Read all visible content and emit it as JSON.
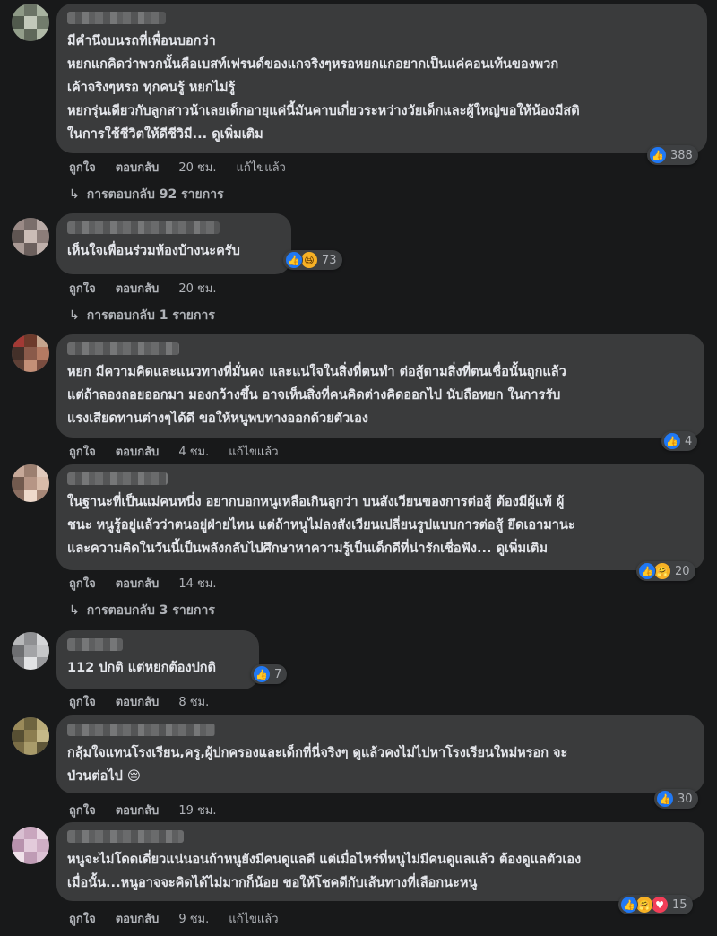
{
  "comments": [
    {
      "lines": [
        "มีคำนึงบนรถที่เพื่อนบอกว่า",
        "หยกแกคิดว่าพวกนั้นคือเบสท์เฟรนด์ของแกจริงๆหรอหยกแกอยากเป็นแค่คอนเท้นของพวก",
        "เค้าจริงๆหรอ ทุกคนรู้ หยกไม่รู้",
        "หยกรุ่นเดียวกับลูกสาวน้าเลยเด็กอายุแค่นี้มันคาบเกี่ยวระหว่างวัยเด็กและผู้ใหญ่ขอให้น้องมีสติ",
        "ในการใช้ชีวิตให้ดีชีวิมี..."
      ],
      "see_more": "ดูเพิ่มเติม",
      "reactions": [
        "like"
      ],
      "reaction_count": "388",
      "like_label": "ถูกใจ",
      "reply_label": "ตอบกลับ",
      "time": "20 ชม.",
      "edited": "แก้ไขแล้ว",
      "replies": "การตอบกลับ 92 รายการ"
    },
    {
      "lines": [
        "เห็นใจเพื่อนร่วมห้องบ้างนะครับ"
      ],
      "see_more": "",
      "reactions": [
        "like",
        "haha"
      ],
      "reaction_count": "73",
      "like_label": "ถูกใจ",
      "reply_label": "ตอบกลับ",
      "time": "20 ชม.",
      "edited": "",
      "replies": "การตอบกลับ 1 รายการ"
    },
    {
      "lines": [
        "หยก มีความคิดและแนวทางที่มั่นคง และแน่ใจในสิ่งที่ตนทำ ต่อสู้ตามสิ่งที่ตนเชื่อนั้นถูกแล้ว",
        "แต่ถ้าลองถอยออกมา มองกว้างขึ้น อาจเห็นสิ่งที่คนคิดต่างคิดออกไป นับถือหยก ในการรับ",
        "แรงเสียดทานต่างๆได้ดี ขอให้หนูพบทางออกด้วยตัวเอง"
      ],
      "see_more": "",
      "reactions": [
        "like"
      ],
      "reaction_count": "4",
      "like_label": "ถูกใจ",
      "reply_label": "ตอบกลับ",
      "time": "4 ชม.",
      "edited": "แก้ไขแล้ว",
      "replies": ""
    },
    {
      "lines": [
        "ในฐานะที่เป็นแม่คนหนึ่ง อยากบอกหนูเหลือเกินลูกว่า บนสังเวียนของการต่อสู้ ต้องมีผู้แพ้ ผู้",
        "ชนะ หนูรู้อยู่แล้วว่าตนอยู่ฝ่ายไหน แต่ถ้าหนูไม่ลงสังเวียนเปลี่ยนรูปแบบการต่อสู้ ยึดเอามานะ",
        "และความคิดในวันนี้เป็นพลังกลับไปศึกษาหาความรู้เป็นเด็กดีที่น่ารักเชื่อฟัง..."
      ],
      "see_more": "ดูเพิ่มเติม",
      "reactions": [
        "like",
        "care"
      ],
      "reaction_count": "20",
      "like_label": "ถูกใจ",
      "reply_label": "ตอบกลับ",
      "time": "14 ชม.",
      "edited": "",
      "replies": "การตอบกลับ 3 รายการ"
    },
    {
      "lines": [
        "112 ปกติ แต่หยกต้องปกติ"
      ],
      "see_more": "",
      "reactions": [
        "like"
      ],
      "reaction_count": "7",
      "like_label": "ถูกใจ",
      "reply_label": "ตอบกลับ",
      "time": "8 ชม.",
      "edited": "",
      "replies": ""
    },
    {
      "lines": [
        "กลุ้มใจแทนโรงเรียน,ครู,ผู้ปกครองและเด็กที่นี่จริงๆ ดูแล้วคงไม่ไปหาโรงเรียนใหม่หรอก จะ",
        "ป่วนต่อไป 😔"
      ],
      "see_more": "",
      "reactions": [
        "like"
      ],
      "reaction_count": "30",
      "like_label": "ถูกใจ",
      "reply_label": "ตอบกลับ",
      "time": "19 ชม.",
      "edited": "",
      "replies": ""
    },
    {
      "lines": [
        "หนูจะไม่โดดเดี่ยวแน่นอนถ้าหนูยังมีคนดูแลดี แต่เมื่อไหร่ที่หนูไม่มีคนดูแลแล้ว ต้องดูแลตัวเอง",
        "เมื่อนั้น...หนูอาจจะคิดได้ไม่มากก็น้อย ขอให้โชคดีกับเส้นทางที่เลือกนะหนู"
      ],
      "see_more": "",
      "reactions": [
        "like",
        "care",
        "love"
      ],
      "reaction_count": "15",
      "like_label": "ถูกใจ",
      "reply_label": "ตอบกลับ",
      "time": "9 ชม.",
      "edited": "แก้ไขแล้ว",
      "replies": ""
    }
  ],
  "icons": {
    "like": "👍",
    "haha": "😆",
    "care": "🤗",
    "love": "♥",
    "reply_arrow": "↳"
  },
  "colors": {
    "background": "#18191a",
    "bubble": "#3a3b3c",
    "text": "#e4e6eb",
    "muted": "#b0b3b8",
    "like_blue": "#2078f4",
    "love_red": "#f33e58",
    "haha_yellow": "#f7b125"
  }
}
